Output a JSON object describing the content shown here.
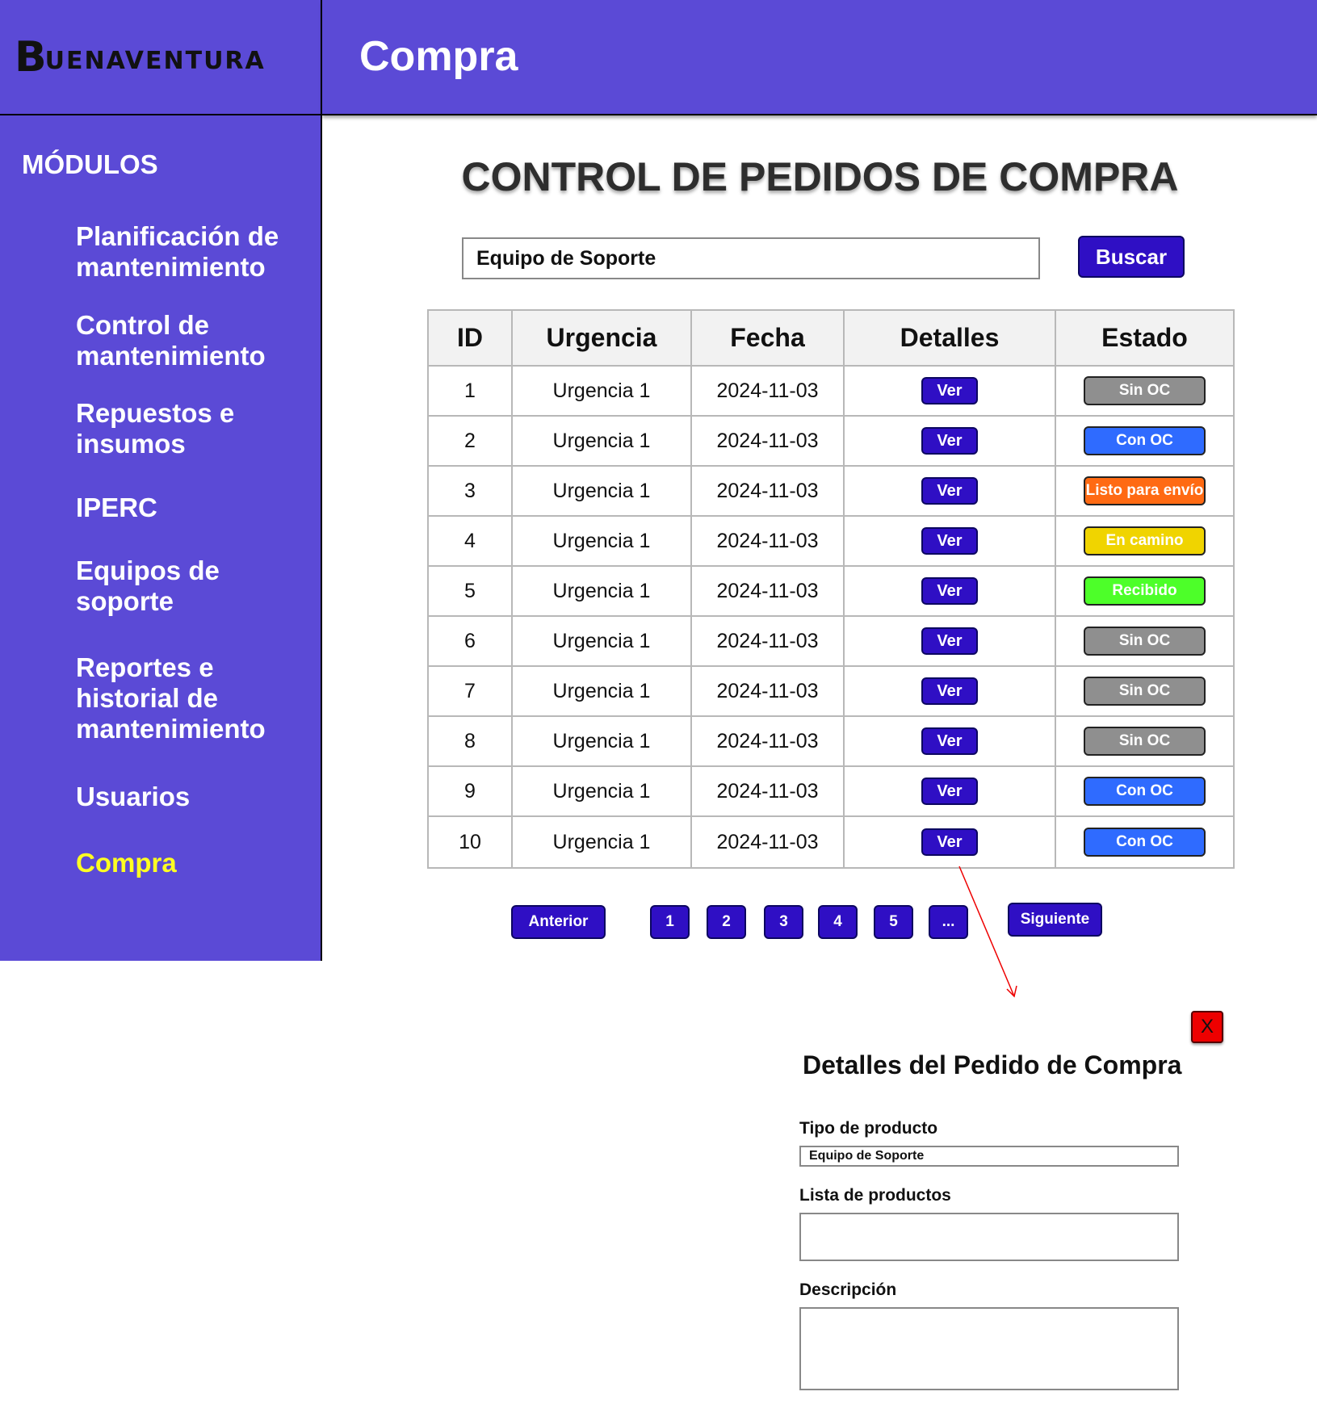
{
  "brand": {
    "logo_letter": "B",
    "logo_rest": "UENAVENTURA"
  },
  "header": {
    "title": "Compra"
  },
  "sidebar": {
    "title": "MÓDULOS",
    "items": [
      {
        "label": "Planificación de mantenimiento"
      },
      {
        "label": "Control de mantenimiento"
      },
      {
        "label": "Repuestos e insumos"
      },
      {
        "label": "IPERC"
      },
      {
        "label": "Equipos de soporte"
      },
      {
        "label": "Reportes e historial de mantenimiento"
      },
      {
        "label": "Usuarios"
      },
      {
        "label": "Compra",
        "active": true
      }
    ]
  },
  "main": {
    "title": "CONTROL DE PEDIDOS DE COMPRA",
    "search": {
      "value": "Equipo de Soporte",
      "button": "Buscar"
    },
    "table": {
      "headers": [
        "ID",
        "Urgencia",
        "Fecha",
        "Detalles",
        "Estado"
      ],
      "detail_button": "Ver",
      "rows": [
        {
          "id": "1",
          "urgencia": "Urgencia 1",
          "fecha": "2024-11-03",
          "estado": "Sin OC",
          "color": "#8f8f8f"
        },
        {
          "id": "2",
          "urgencia": "Urgencia 1",
          "fecha": "2024-11-03",
          "estado": "Con OC",
          "color": "#2f6bff"
        },
        {
          "id": "3",
          "urgencia": "Urgencia 1",
          "fecha": "2024-11-03",
          "estado": "Listo para envío",
          "color": "#ff6a13"
        },
        {
          "id": "4",
          "urgencia": "Urgencia 1",
          "fecha": "2024-11-03",
          "estado": "En camino",
          "color": "#f0d400"
        },
        {
          "id": "5",
          "urgencia": "Urgencia 1",
          "fecha": "2024-11-03",
          "estado": "Recibido",
          "color": "#4dff29"
        },
        {
          "id": "6",
          "urgencia": "Urgencia 1",
          "fecha": "2024-11-03",
          "estado": "Sin OC",
          "color": "#8f8f8f"
        },
        {
          "id": "7",
          "urgencia": "Urgencia 1",
          "fecha": "2024-11-03",
          "estado": "Sin OC",
          "color": "#8f8f8f"
        },
        {
          "id": "8",
          "urgencia": "Urgencia 1",
          "fecha": "2024-11-03",
          "estado": "Sin OC",
          "color": "#8f8f8f"
        },
        {
          "id": "9",
          "urgencia": "Urgencia 1",
          "fecha": "2024-11-03",
          "estado": "Con OC",
          "color": "#2f6bff"
        },
        {
          "id": "10",
          "urgencia": "Urgencia 1",
          "fecha": "2024-11-03",
          "estado": "Con OC",
          "color": "#2f6bff"
        }
      ]
    },
    "pagination": {
      "prev": "Anterior",
      "pages": [
        "1",
        "2",
        "3",
        "4",
        "5",
        "..."
      ],
      "next": "Siguiente"
    }
  },
  "details_panel": {
    "close_label": "X",
    "title": "Detalles del Pedido de Compra",
    "fields": {
      "tipo_label": "Tipo de producto",
      "tipo_value": "Equipo de Soporte",
      "lista_label": "Lista de productos",
      "lista_value": "",
      "descripcion_label": "Descripción",
      "descripcion_value": ""
    }
  },
  "colors": {
    "brand_purple": "#5b4ad6",
    "button_purple": "#2f0fc4",
    "active_item": "#ffff22",
    "connector_red": "#ee0000"
  }
}
